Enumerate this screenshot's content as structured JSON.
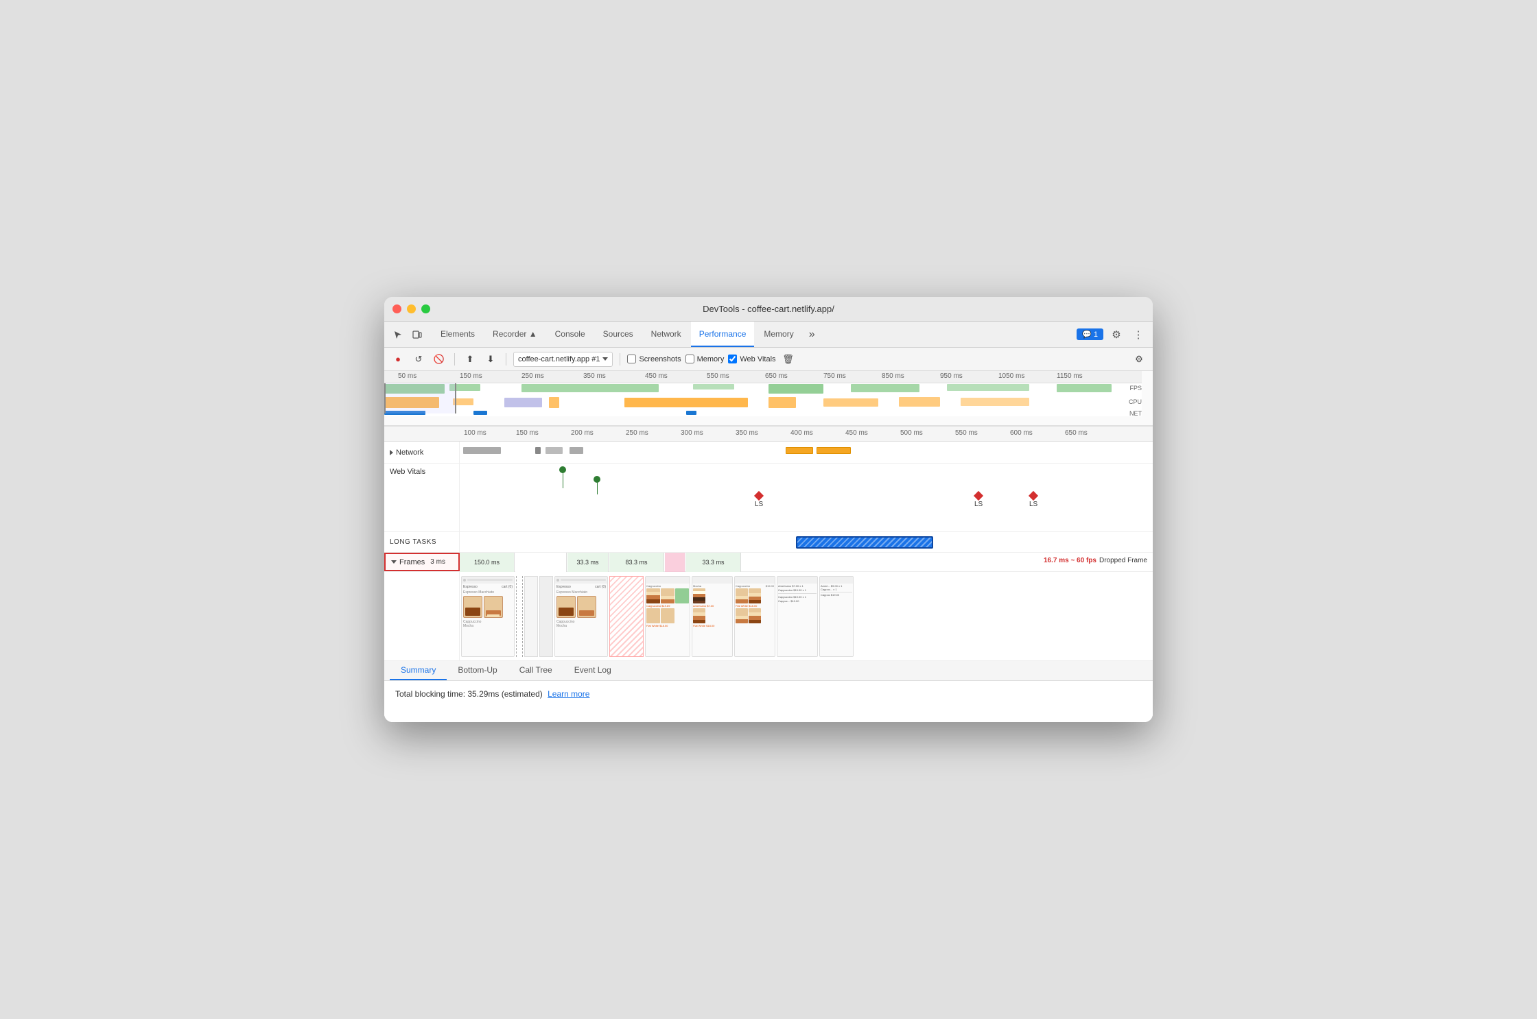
{
  "window": {
    "title": "DevTools - coffee-cart.netlify.app/"
  },
  "tabs": [
    {
      "label": "Elements",
      "active": false
    },
    {
      "label": "Recorder ▲",
      "active": false
    },
    {
      "label": "Console",
      "active": false
    },
    {
      "label": "Sources",
      "active": false
    },
    {
      "label": "Network",
      "active": false
    },
    {
      "label": "Performance",
      "active": true
    },
    {
      "label": "Memory",
      "active": false
    }
  ],
  "toolbar": {
    "record_label": "●",
    "refresh_label": "↺",
    "clear_label": "🚫",
    "upload_label": "⬆",
    "download_label": "⬇",
    "profile_selector": "coffee-cart.netlify.app #1",
    "screenshots_label": "Screenshots",
    "memory_label": "Memory",
    "web_vitals_label": "Web Vitals",
    "settings_label": "⚙"
  },
  "overview": {
    "time_marks_top": [
      "50 ms",
      "150 ms",
      "250 ms",
      "350 ms",
      "450 ms",
      "550 ms",
      "650 ms",
      "750 ms",
      "850 ms",
      "950 ms",
      "1050 ms",
      "1150 ms"
    ],
    "labels": {
      "fps": "FPS",
      "cpu": "CPU",
      "net": "NET"
    }
  },
  "timeline": {
    "time_marks": [
      "100 ms",
      "150 ms",
      "200 ms",
      "250 ms",
      "300 ms",
      "350 ms",
      "400 ms",
      "450 ms",
      "500 ms",
      "550 ms",
      "600 ms",
      "650 ms"
    ],
    "tracks": {
      "network": "Network",
      "web_vitals": "Web Vitals",
      "long_tasks": "LONG TASKS",
      "frames": "Frames",
      "frames_ms": "3 ms"
    },
    "frame_segments": [
      {
        "label": "150.0 ms",
        "width": 18,
        "x": 9
      },
      {
        "label": "33.3 ms",
        "width": 9,
        "x": 55
      },
      {
        "label": "83.3 ms",
        "width": 12,
        "x": 64
      },
      {
        "label": "33.3 ms",
        "width": 12,
        "x": 80
      }
    ],
    "dropped_frame": {
      "fps_rate": "16.7 ms ~ 60 fps",
      "label": "Dropped Frame"
    },
    "wv_markers": [
      {
        "label": "LS",
        "x": 55
      },
      {
        "label": "LS",
        "x": 88
      },
      {
        "label": "LS",
        "x": 95
      }
    ]
  },
  "analysis": {
    "tabs": [
      "Summary",
      "Bottom-Up",
      "Call Tree",
      "Event Log"
    ],
    "active_tab": "Summary",
    "summary_text": "Total blocking time: 35.29ms (estimated)",
    "learn_more": "Learn more"
  },
  "badge": {
    "count": "1"
  }
}
